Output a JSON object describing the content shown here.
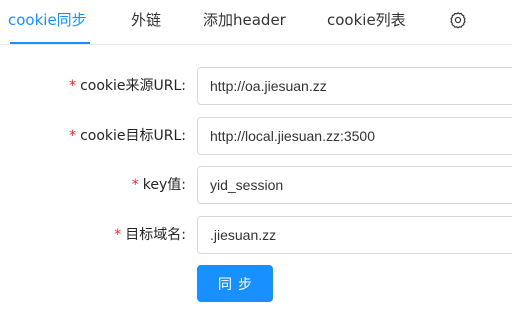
{
  "tabs": [
    {
      "label": "cookie同步",
      "active": true
    },
    {
      "label": "外链",
      "active": false
    },
    {
      "label": "添加header",
      "active": false
    },
    {
      "label": "cookie列表",
      "active": false
    }
  ],
  "settings_icon": "gear-icon",
  "form": {
    "required_mark": "*",
    "fields": [
      {
        "label": "cookie来源URL:",
        "value": "http://oa.jiesuan.zz"
      },
      {
        "label": "cookie目标URL:",
        "value": "http://local.jiesuan.zz:3500"
      },
      {
        "label": "key值:",
        "value": "yid_session"
      },
      {
        "label": "目标域名:",
        "value": ".jiesuan.zz"
      }
    ],
    "submit_label": "同步"
  },
  "colors": {
    "accent": "#1890ff",
    "required": "#f5222d",
    "border": "#d9d9d9"
  }
}
